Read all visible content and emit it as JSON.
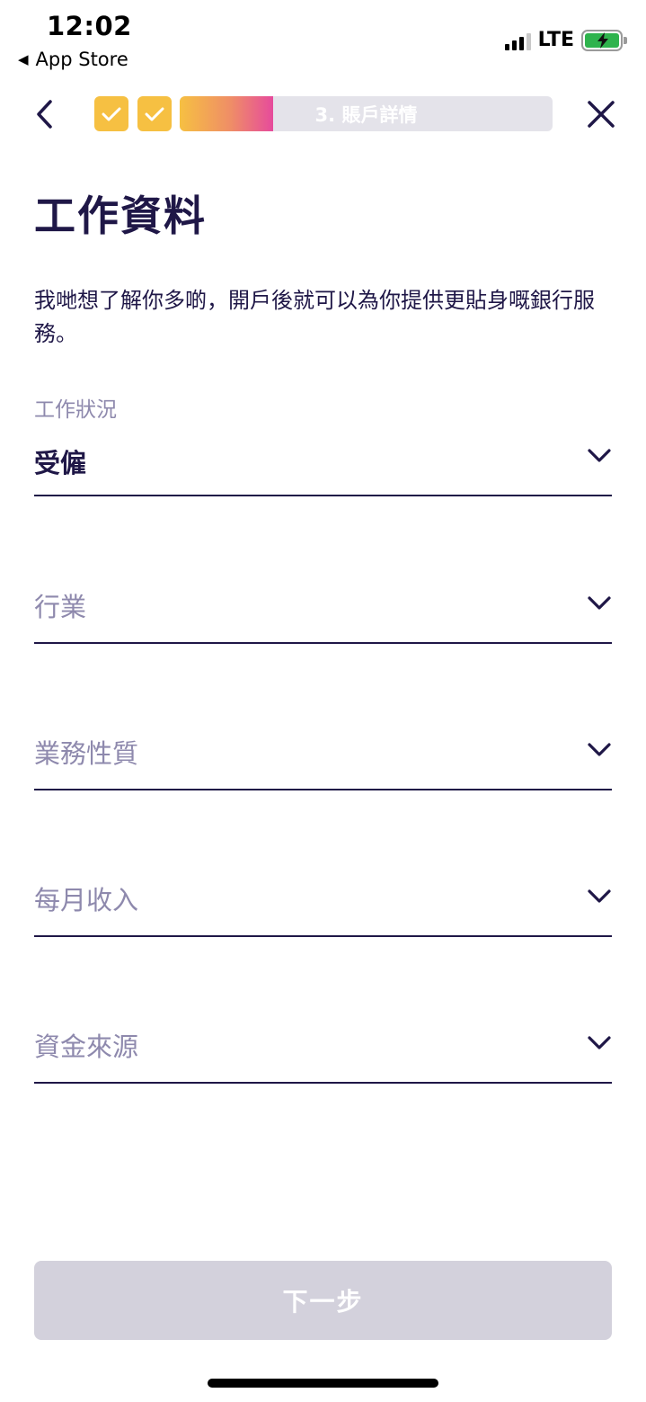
{
  "status_bar": {
    "time": "12:02",
    "back_app": "App Store",
    "network": "LTE"
  },
  "progress": {
    "step_label": "3. 賬戶詳情",
    "fraction_filled": 0.25,
    "completed_steps": 2
  },
  "page": {
    "title": "工作資料",
    "description": "我哋想了解你多啲，開戶後就可以為你提供更貼身嘅銀行服務。"
  },
  "fields": {
    "employment_status": {
      "label": "工作狀況",
      "value": "受僱"
    },
    "industry": {
      "placeholder": "行業"
    },
    "business_nature": {
      "placeholder": "業務性質"
    },
    "monthly_income": {
      "placeholder": "每月收入"
    },
    "source_of_funds": {
      "placeholder": "資金來源"
    }
  },
  "actions": {
    "next_label": "下一步"
  },
  "colors": {
    "primary_text": "#1f1747",
    "muted_text": "#8e89ad",
    "step_done": "#f6c042",
    "gradient_end": "#e64b9c",
    "disabled_button": "#d3d1dc"
  }
}
